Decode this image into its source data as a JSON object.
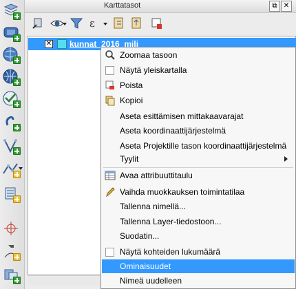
{
  "panel": {
    "title": "Karttatasot",
    "float_button": "⧉",
    "close_button": "✕"
  },
  "layer": {
    "name": "kunnat_2016_milj",
    "checked_mark": "✕",
    "swatch_color": "#55ddee"
  },
  "context_menu": {
    "items": [
      {
        "label": "Zoomaa tasoon",
        "icon": "zoom-icon"
      },
      {
        "label": "Näytä yleiskartalla",
        "icon": "checkbox"
      },
      {
        "label": "Poista",
        "icon": "remove-layer-icon"
      },
      {
        "label": "Kopioi",
        "icon": "duplicate-layer-icon"
      },
      {
        "label": "Aseta esittämisen mittakaavarajat",
        "icon": ""
      },
      {
        "label": "Aseta koordinaattijärjestelmä",
        "icon": ""
      },
      {
        "label": "Aseta Projektille tason koordinaattijärjestelmä",
        "icon": ""
      },
      {
        "label": "Tyylit",
        "icon": "",
        "submenu": true
      },
      {
        "label": "Avaa attribuuttitaulu",
        "icon": "attribute-table-icon"
      },
      {
        "label": "Vaihda muokkauksen toimintatilaa",
        "icon": "pencil-icon"
      },
      {
        "label": "Tallenna nimellä...",
        "icon": ""
      },
      {
        "label": "Tallenna Layer-tiedostoon...",
        "icon": ""
      },
      {
        "label": "Suodatin...",
        "icon": ""
      },
      {
        "label": "Näytä kohteiden lukumäärä",
        "icon": "checkbox"
      },
      {
        "label": "Ominaisuudet",
        "icon": "",
        "highlighted": true
      },
      {
        "label": "Nimeä uudelleen",
        "icon": ""
      }
    ]
  },
  "colors": {
    "selection": "#3399ff",
    "menu_bg": "#f7f7f7"
  }
}
